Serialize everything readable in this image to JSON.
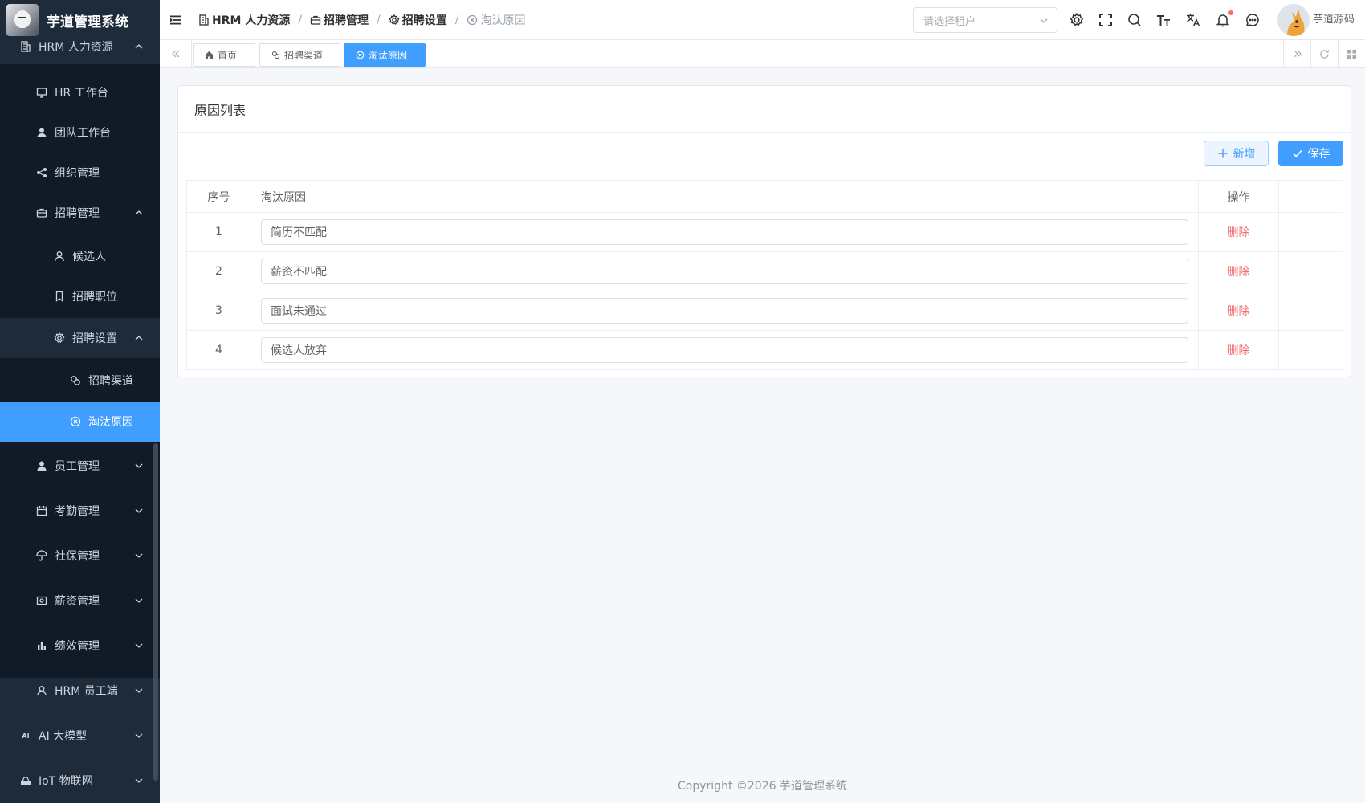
{
  "app": {
    "title": "芋道管理系统"
  },
  "sidebar": {
    "hrm": {
      "label": "HRM 人力资源"
    },
    "items": [
      {
        "label": "HR 工作台"
      },
      {
        "label": "团队工作台"
      },
      {
        "label": "组织管理"
      }
    ],
    "recruit": {
      "label": "招聘管理",
      "items": [
        {
          "label": "候选人"
        },
        {
          "label": "招聘职位"
        }
      ],
      "settings": {
        "label": "招聘设置",
        "items": [
          {
            "label": "招聘渠道"
          },
          {
            "label": "淘汰原因"
          }
        ]
      }
    },
    "groups": [
      {
        "label": "员工管理"
      },
      {
        "label": "考勤管理"
      },
      {
        "label": "社保管理"
      },
      {
        "label": "薪资管理"
      },
      {
        "label": "绩效管理"
      },
      {
        "label": "HRM 员工端"
      }
    ],
    "top": [
      {
        "label": "AI 大模型"
      },
      {
        "label": "IoT 物联网"
      }
    ]
  },
  "header": {
    "breadcrumb": [
      "HRM 人力资源",
      "招聘管理",
      "招聘设置",
      "淘汰原因"
    ],
    "tenant_placeholder": "请选择租户",
    "user_name": "芋道源码"
  },
  "tags": [
    "首页",
    "招聘渠道",
    "淘汰原因"
  ],
  "card": {
    "title": "原因列表",
    "add_label": "新增",
    "save_label": "保存",
    "columns": [
      "序号",
      "淘汰原因",
      "操作"
    ],
    "rows": [
      {
        "idx": "1",
        "reason": "简历不匹配",
        "action": "删除"
      },
      {
        "idx": "2",
        "reason": "薪资不匹配",
        "action": "删除"
      },
      {
        "idx": "3",
        "reason": "面试未通过",
        "action": "删除"
      },
      {
        "idx": "4",
        "reason": "候选人放弃",
        "action": "删除"
      }
    ]
  },
  "footer": {
    "copyright": "Copyright ©2026 芋道管理系统"
  },
  "colors": {
    "primary": "#409eff",
    "danger": "#f56c6c",
    "sidebar_bg": "#1d2b3a",
    "submenu_bg": "#101b27"
  }
}
